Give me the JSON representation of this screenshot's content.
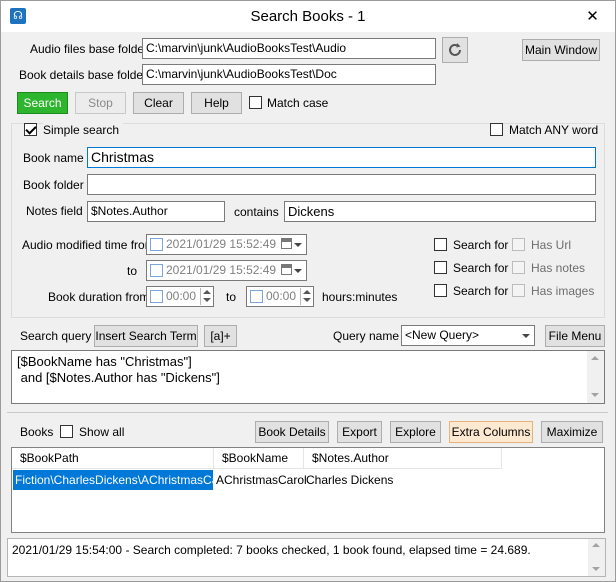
{
  "window": {
    "title": "Search Books - 1",
    "close_glyph": "✕"
  },
  "paths": {
    "audio_label": "Audio files base folder",
    "audio_value": "C:\\marvin\\junk\\AudioBooksTest\\Audio",
    "details_label": "Book details base folder",
    "details_value": "C:\\marvin\\junk\\AudioBooksTest\\Doc",
    "main_window_button": "Main Window",
    "refresh_icon": "refresh-icon"
  },
  "toolbar": {
    "search": "Search",
    "stop": "Stop",
    "clear": "Clear",
    "help": "Help",
    "match_case": "Match case",
    "search_color": "#2db52d"
  },
  "filters": {
    "simple_search": "Simple search",
    "match_any_word": "Match ANY word",
    "book_name_label": "Book name",
    "book_name_value": "Christmas",
    "book_folder_label": "Book folder",
    "book_folder_value": "",
    "notes_field_label": "Notes field",
    "notes_field_value": "$Notes.Author",
    "contains_label": "contains",
    "contains_value": "Dickens",
    "audio_modified_label": "Audio modified time from",
    "to_label": "to",
    "from_date": "2021/01/29 15:52:49",
    "to_date": "2021/01/29 15:52:49",
    "duration_label": "Book duration from",
    "duration_to_label": "to",
    "duration_from": "00:00",
    "duration_to": "00:00",
    "hours_minutes": "hours:minutes",
    "search_for_1": "Search for",
    "search_for_2": "Search for",
    "search_for_3": "Search for",
    "has_url": "Has Url",
    "has_notes": "Has notes",
    "has_images": "Has images"
  },
  "query": {
    "label": "Search query",
    "insert_term": "Insert Search Term",
    "add_button": "[a]+",
    "name_label": "Query name",
    "name_value": "<New Query>",
    "file_menu": "File Menu",
    "text": "[$BookName has \"Christmas\"]\n and [$Notes.Author has \"Dickens\"]"
  },
  "books": {
    "label": "Books",
    "show_all": "Show all",
    "book_details": "Book Details",
    "export": "Export",
    "explore": "Explore",
    "extra_columns": "Extra Columns",
    "maximize": "Maximize",
    "columns": [
      "$BookPath",
      "$BookName",
      "$Notes.Author"
    ],
    "rows": [
      [
        "Fiction\\CharlesDickens\\AChristmasCarol",
        "AChristmasCarol",
        "Charles Dickens"
      ]
    ],
    "selected_color": "#0078d7"
  },
  "status": {
    "text": "2021/01/29 15:54:00 - Search completed: 7 books checked, 1 book found, elapsed time = 24.689."
  }
}
